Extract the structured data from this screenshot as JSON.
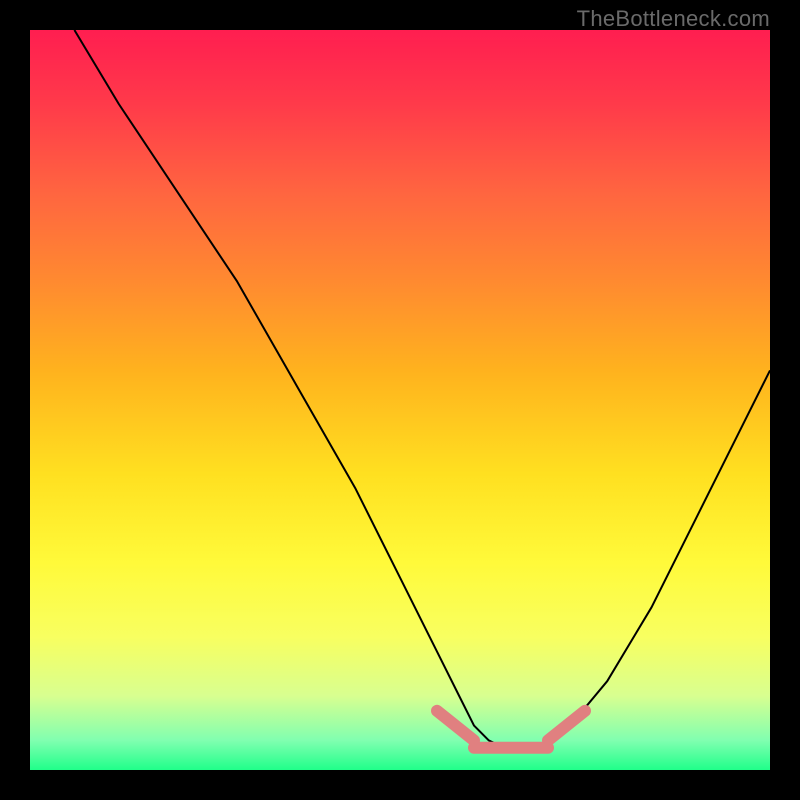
{
  "watermark": "TheBottleneck.com",
  "chart_data": {
    "type": "line",
    "title": "",
    "xlabel": "",
    "ylabel": "",
    "xlim": [
      0,
      100
    ],
    "ylim": [
      0,
      100
    ],
    "series": [
      {
        "name": "bottleneck-curve",
        "x": [
          6,
          12,
          20,
          28,
          36,
          44,
          50,
          55,
          58,
          60,
          62,
          64,
          66,
          68,
          70,
          73,
          78,
          84,
          90,
          96,
          100
        ],
        "y": [
          100,
          90,
          78,
          66,
          52,
          38,
          26,
          16,
          10,
          6,
          4,
          3,
          3,
          3,
          4,
          6,
          12,
          22,
          34,
          46,
          54
        ]
      }
    ],
    "highlight_zone": {
      "name": "optimal-range-marker",
      "color": "#e08080",
      "segments": [
        {
          "x": [
            55,
            60
          ],
          "y": [
            8,
            4
          ]
        },
        {
          "x": [
            60,
            70
          ],
          "y": [
            3,
            3
          ]
        },
        {
          "x": [
            70,
            75
          ],
          "y": [
            4,
            8
          ]
        }
      ]
    }
  }
}
